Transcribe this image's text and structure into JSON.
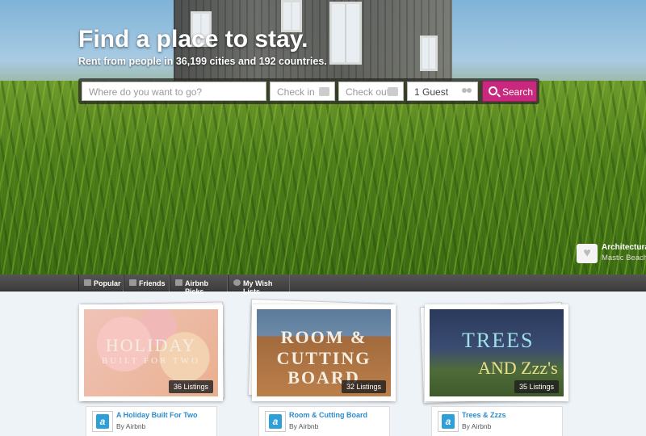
{
  "hero": {
    "title": "Find a place to stay.",
    "subtitle": "Rent from people in 36,199 cities and 192 countries.",
    "search": {
      "where_placeholder": "Where do you want to go?",
      "checkin_placeholder": "Check in",
      "checkout_placeholder": "Check out",
      "guests_value": "1 Guest",
      "search_label": "Search",
      "search_color": "#c8287e"
    },
    "photo_credit": {
      "name": "Architectura",
      "location": "Mastic Beach"
    }
  },
  "nav": {
    "items": [
      {
        "label": "Popular",
        "icon": "home-icon"
      },
      {
        "label": "Friends",
        "icon": "friends-icon"
      },
      {
        "label": "Airbnb Picks",
        "icon": "airbnb-icon"
      },
      {
        "label": "My Wish Lists",
        "icon": "heart-icon"
      }
    ]
  },
  "collections": [
    {
      "title": "A Holiday Built For Two",
      "by": "By Airbnb",
      "listings": "36 Listings",
      "art": [
        "HOLIDAY",
        "BUILT FOR TWO"
      ]
    },
    {
      "title": "Room & Cutting Board",
      "by": "By Airbnb",
      "listings": "32 Listings",
      "art": [
        "ROOM &",
        "CUTTING",
        "BOARD"
      ]
    },
    {
      "title": "Trees & Zzzs",
      "by": "By Airbnb",
      "listings": "35 Listings",
      "art": [
        "TREES",
        "AND Zzz's"
      ]
    }
  ],
  "colors": {
    "brand_pink": "#c8287e",
    "link_blue": "#2d8ccf"
  }
}
